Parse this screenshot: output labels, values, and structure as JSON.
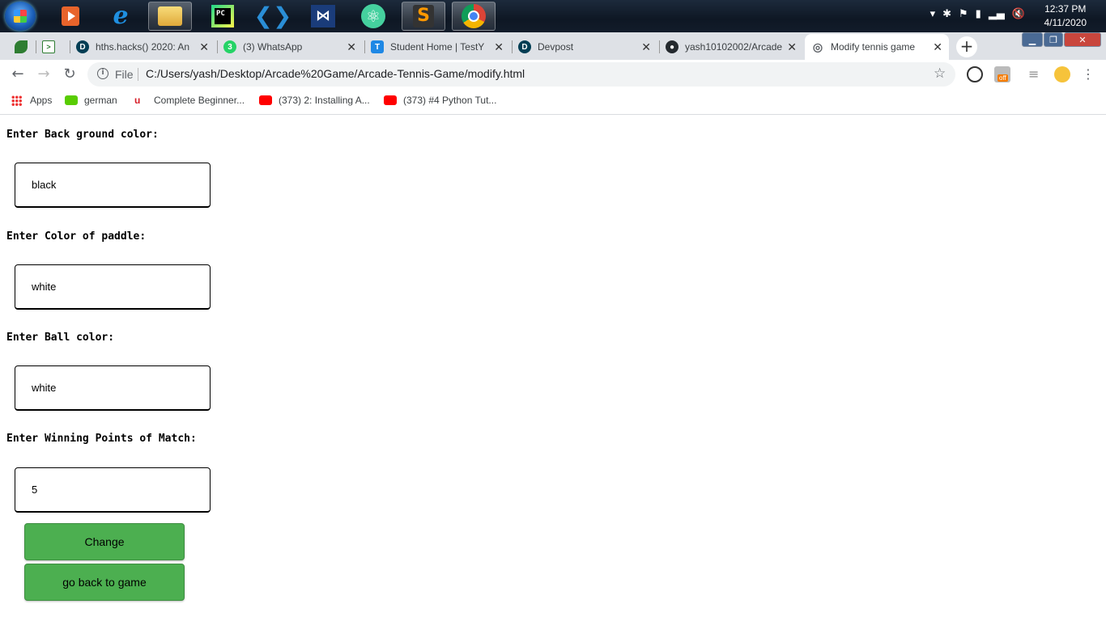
{
  "taskbar": {
    "clock": {
      "time": "12:37 PM",
      "date": "4/11/2020"
    },
    "apps": [
      {
        "name": "media-player-icon",
        "color": "#e8642b"
      },
      {
        "name": "internet-explorer-icon",
        "color": "#1f8fe0"
      },
      {
        "name": "file-explorer-icon",
        "color": "#f3c44b"
      },
      {
        "name": "pycharm-icon",
        "color": "#21d789"
      },
      {
        "name": "vscode-icon",
        "color": "#2a8ed6"
      },
      {
        "name": "visual-studio-icon",
        "color": "#1a3c7a"
      },
      {
        "name": "atom-icon",
        "color": "#45d09e"
      },
      {
        "name": "sublime-text-icon",
        "color": "#ff9800"
      },
      {
        "name": "chrome-icon",
        "color": "#4285f4"
      }
    ]
  },
  "browser": {
    "tabs": [
      {
        "title": "hths.hacks() 2020: An",
        "icon_letter": "D",
        "icon_color": "#003e54"
      },
      {
        "title": "(3) WhatsApp",
        "icon_letter": "3",
        "icon_color": "#25d366"
      },
      {
        "title": "Student Home | TestY",
        "icon_letter": "T",
        "icon_color": "#1e88e5"
      },
      {
        "title": "Devpost",
        "icon_letter": "D",
        "icon_color": "#003e54"
      },
      {
        "title": "yash10102002/Arcade",
        "icon_letter": "●",
        "icon_color": "#24292e"
      },
      {
        "title": "Modify tennis game",
        "icon_letter": "◎",
        "icon_color": "#5f6368"
      }
    ],
    "new_tab_label": "+",
    "url_scheme": "File",
    "url": "C:/Users/yash/Desktop/Arcade%20Game/Arcade-Tennis-Game/modify.html",
    "bookmarks": [
      {
        "label": "Apps"
      },
      {
        "label": "german",
        "color": "#58cc02"
      },
      {
        "label": "Complete Beginner...",
        "color": "#d71e28"
      },
      {
        "label": "(373) 2: Installing A...",
        "color": "#ff0000"
      },
      {
        "label": "(373) #4 Python Tut...",
        "color": "#ff0000"
      }
    ],
    "extension_badge": "off"
  },
  "form": {
    "background_label": "Enter Back ground color:",
    "background_value": "black",
    "paddle_label": "Enter Color of paddle:",
    "paddle_value": "white",
    "ball_label": "Enter Ball color:",
    "ball_value": "white",
    "points_label": "Enter Winning Points of Match:",
    "points_value": "5",
    "change_button": "Change",
    "back_button": "go back to game",
    "button_color": "#4caf50"
  }
}
